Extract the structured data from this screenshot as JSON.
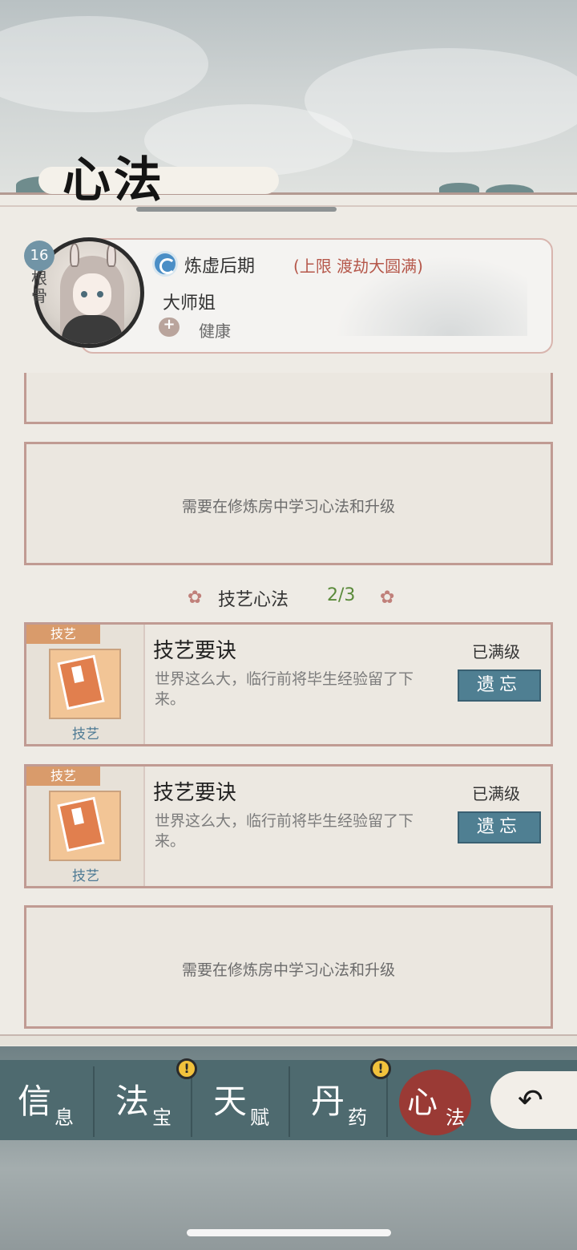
{
  "page_title": "心法",
  "character": {
    "level": "16",
    "root_label": "根骨",
    "realm": "炼虚后期",
    "realm_limit": "(上限 渡劫大圆满)",
    "name": "大师姐",
    "health": "健康"
  },
  "empty_slot_text": "需要在修炼房中学习心法和升级",
  "section": {
    "title": "技艺心法",
    "count": "2/3",
    "flower_left": "✿",
    "flower_right": "✿"
  },
  "skills": [
    {
      "tag": "技艺",
      "kind": "技艺",
      "name": "技艺要诀",
      "description": "世界这么大，临行前将毕生经验留了下来。",
      "level": "已满级",
      "forget_label": "遗忘"
    },
    {
      "tag": "技艺",
      "kind": "技艺",
      "name": "技艺要诀",
      "description": "世界这么大，临行前将毕生经验留了下来。",
      "level": "已满级",
      "forget_label": "遗忘"
    }
  ],
  "nav": [
    {
      "big": "信",
      "small": "息",
      "alert": false
    },
    {
      "big": "法",
      "small": "宝",
      "alert": true
    },
    {
      "big": "天",
      "small": "赋",
      "alert": false
    },
    {
      "big": "丹",
      "small": "药",
      "alert": true
    },
    {
      "big": "心",
      "small": "法",
      "alert": false,
      "active": true
    }
  ],
  "alert_symbol": "!",
  "back_icon": "↶",
  "colors": {
    "accent_red": "#b5574a",
    "button_teal": "#4f7f92",
    "count_green": "#5a8a3a",
    "nav_bg": "#4e6a6f"
  }
}
